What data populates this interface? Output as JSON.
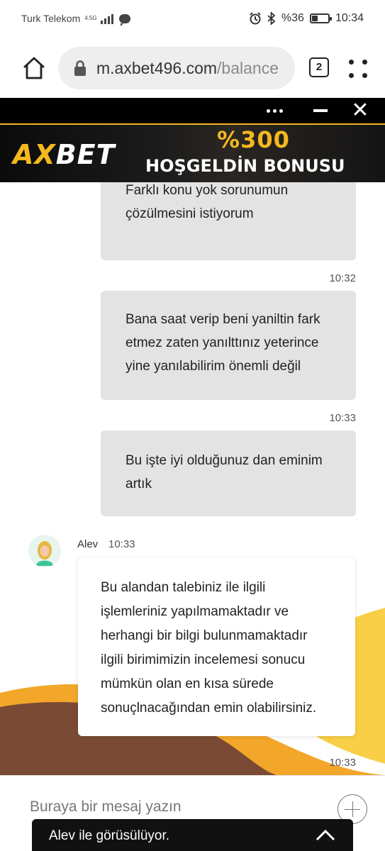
{
  "status_bar": {
    "carrier": "Turk Telekom",
    "network": "4.5G",
    "battery": "%36",
    "battery_level": 0.36,
    "time": "10:34"
  },
  "browser": {
    "url_main": "m.axbet496.com",
    "url_path": "/balance",
    "tab_count": "2"
  },
  "ad": {
    "logo_ax": "AX",
    "logo_bet": "BET",
    "promo_line1": "%300",
    "promo_line2": "HOŞGELDİN BONUSU",
    "accent_color": "#f5b81f"
  },
  "messages": [
    {
      "from": "user",
      "text": "Farklı konu yok sorunumun çözülmesini istiyorum",
      "time": "10:32"
    },
    {
      "from": "user",
      "text": "Bana saat verip beni yaniltin fark etmez zaten yanılttınız yeterince yine yanılabilirim önemli değil",
      "time": "10:33"
    },
    {
      "from": "user",
      "text": "Bu işte iyi olduğunuz dan eminim artık",
      "time": "10:33"
    },
    {
      "from": "agent",
      "name": "Alev",
      "header_time": "10:33",
      "text": "Bu alandan talebiniz ile ilgili işlemleriniz yapılmamaktadır ve herhangi bir bilgi bulunmamaktadır ilgili birimimizin incelemesi sonucu mümkün olan en kısa sürede sonuçlnacağından emin olabilirsiniz.",
      "time": "10:33"
    }
  ],
  "composer": {
    "placeholder": "Buraya bir mesaj yazın"
  },
  "session_bar": {
    "text": "Alev ile görüsülüyor."
  }
}
